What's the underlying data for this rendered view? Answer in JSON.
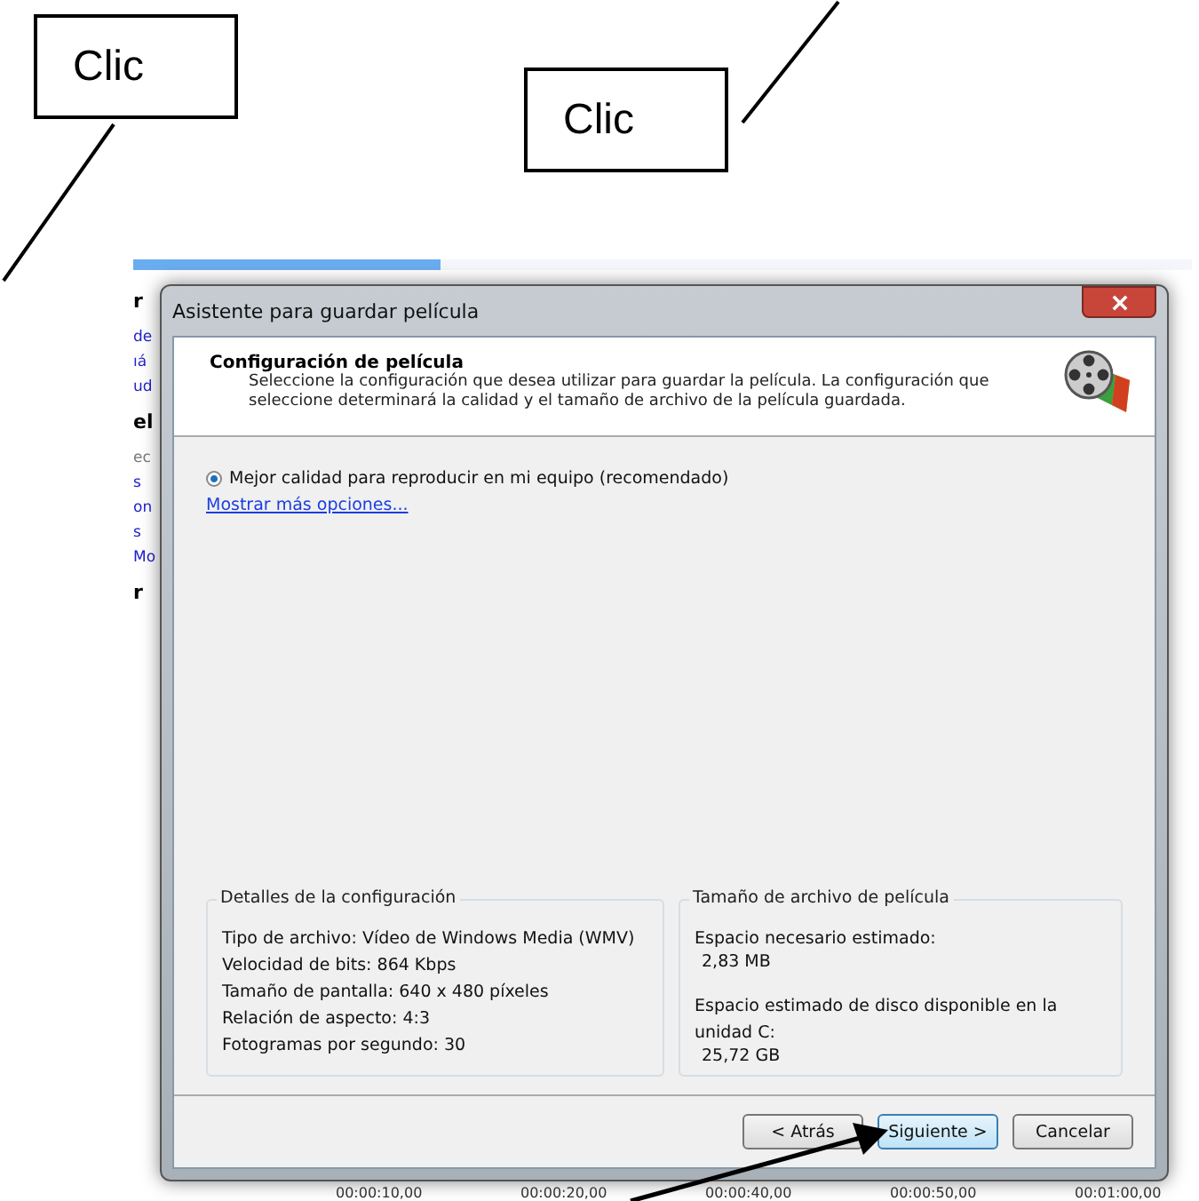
{
  "callouts": [
    {
      "text": "Clic"
    },
    {
      "text": "Clic"
    }
  ],
  "background_app": {
    "progress": {
      "level": 0.29
    },
    "fragments": [
      {
        "kind": "heading",
        "text": "r"
      },
      {
        "kind": "link",
        "text": "de"
      },
      {
        "kind": "link",
        "text": "ıá"
      },
      {
        "kind": "link",
        "text": "ud"
      },
      {
        "kind": "heading",
        "text": "el"
      },
      {
        "kind": "text",
        "text": "ec"
      },
      {
        "kind": "link",
        "text": "s"
      },
      {
        "kind": "link",
        "text": "on"
      },
      {
        "kind": "link",
        "text": "s"
      },
      {
        "kind": "link",
        "text": "Mo"
      },
      {
        "kind": "heading",
        "text": "r"
      }
    ],
    "timeline": [
      "00:00:10,00",
      "00:00:20,00",
      "00:00:40,00",
      "00:00:50,00",
      "00:01:00,00"
    ]
  },
  "dialog": {
    "title": "Asistente para guardar película",
    "header": {
      "title": "Configuración de película",
      "description": "Seleccione la configuración que desea utilizar para guardar la película. La configuración que seleccione determinará la calidad y el tamaño de archivo de la película guardada."
    },
    "options": [
      {
        "label": "Mejor calidad para reproducir en mi equipo (recomendado)",
        "selected": true
      }
    ],
    "more_link": "Mostrar más opciones...",
    "details": {
      "title": "Detalles de la configuración",
      "lines": [
        "Tipo de archivo: Vídeo de Windows Media (WMV)",
        "Velocidad de bits: 864 Kbps",
        "Tamaño de pantalla: 640 x 480 píxeles",
        "Relación de aspecto: 4:3",
        "Fotogramas por segundo: 30"
      ]
    },
    "file_size": {
      "title": "Tamaño de archivo de película",
      "items": [
        {
          "label": "Espacio necesario estimado:",
          "value": "2,83 MB"
        },
        {
          "label": "Espacio estimado de disco disponible en la unidad C:",
          "value": "25,72 GB"
        }
      ]
    },
    "buttons": [
      {
        "label": "< Atrás",
        "focused": false
      },
      {
        "label": "Siguiente >",
        "focused": true
      },
      {
        "label": "Cancelar",
        "focused": false
      }
    ]
  }
}
